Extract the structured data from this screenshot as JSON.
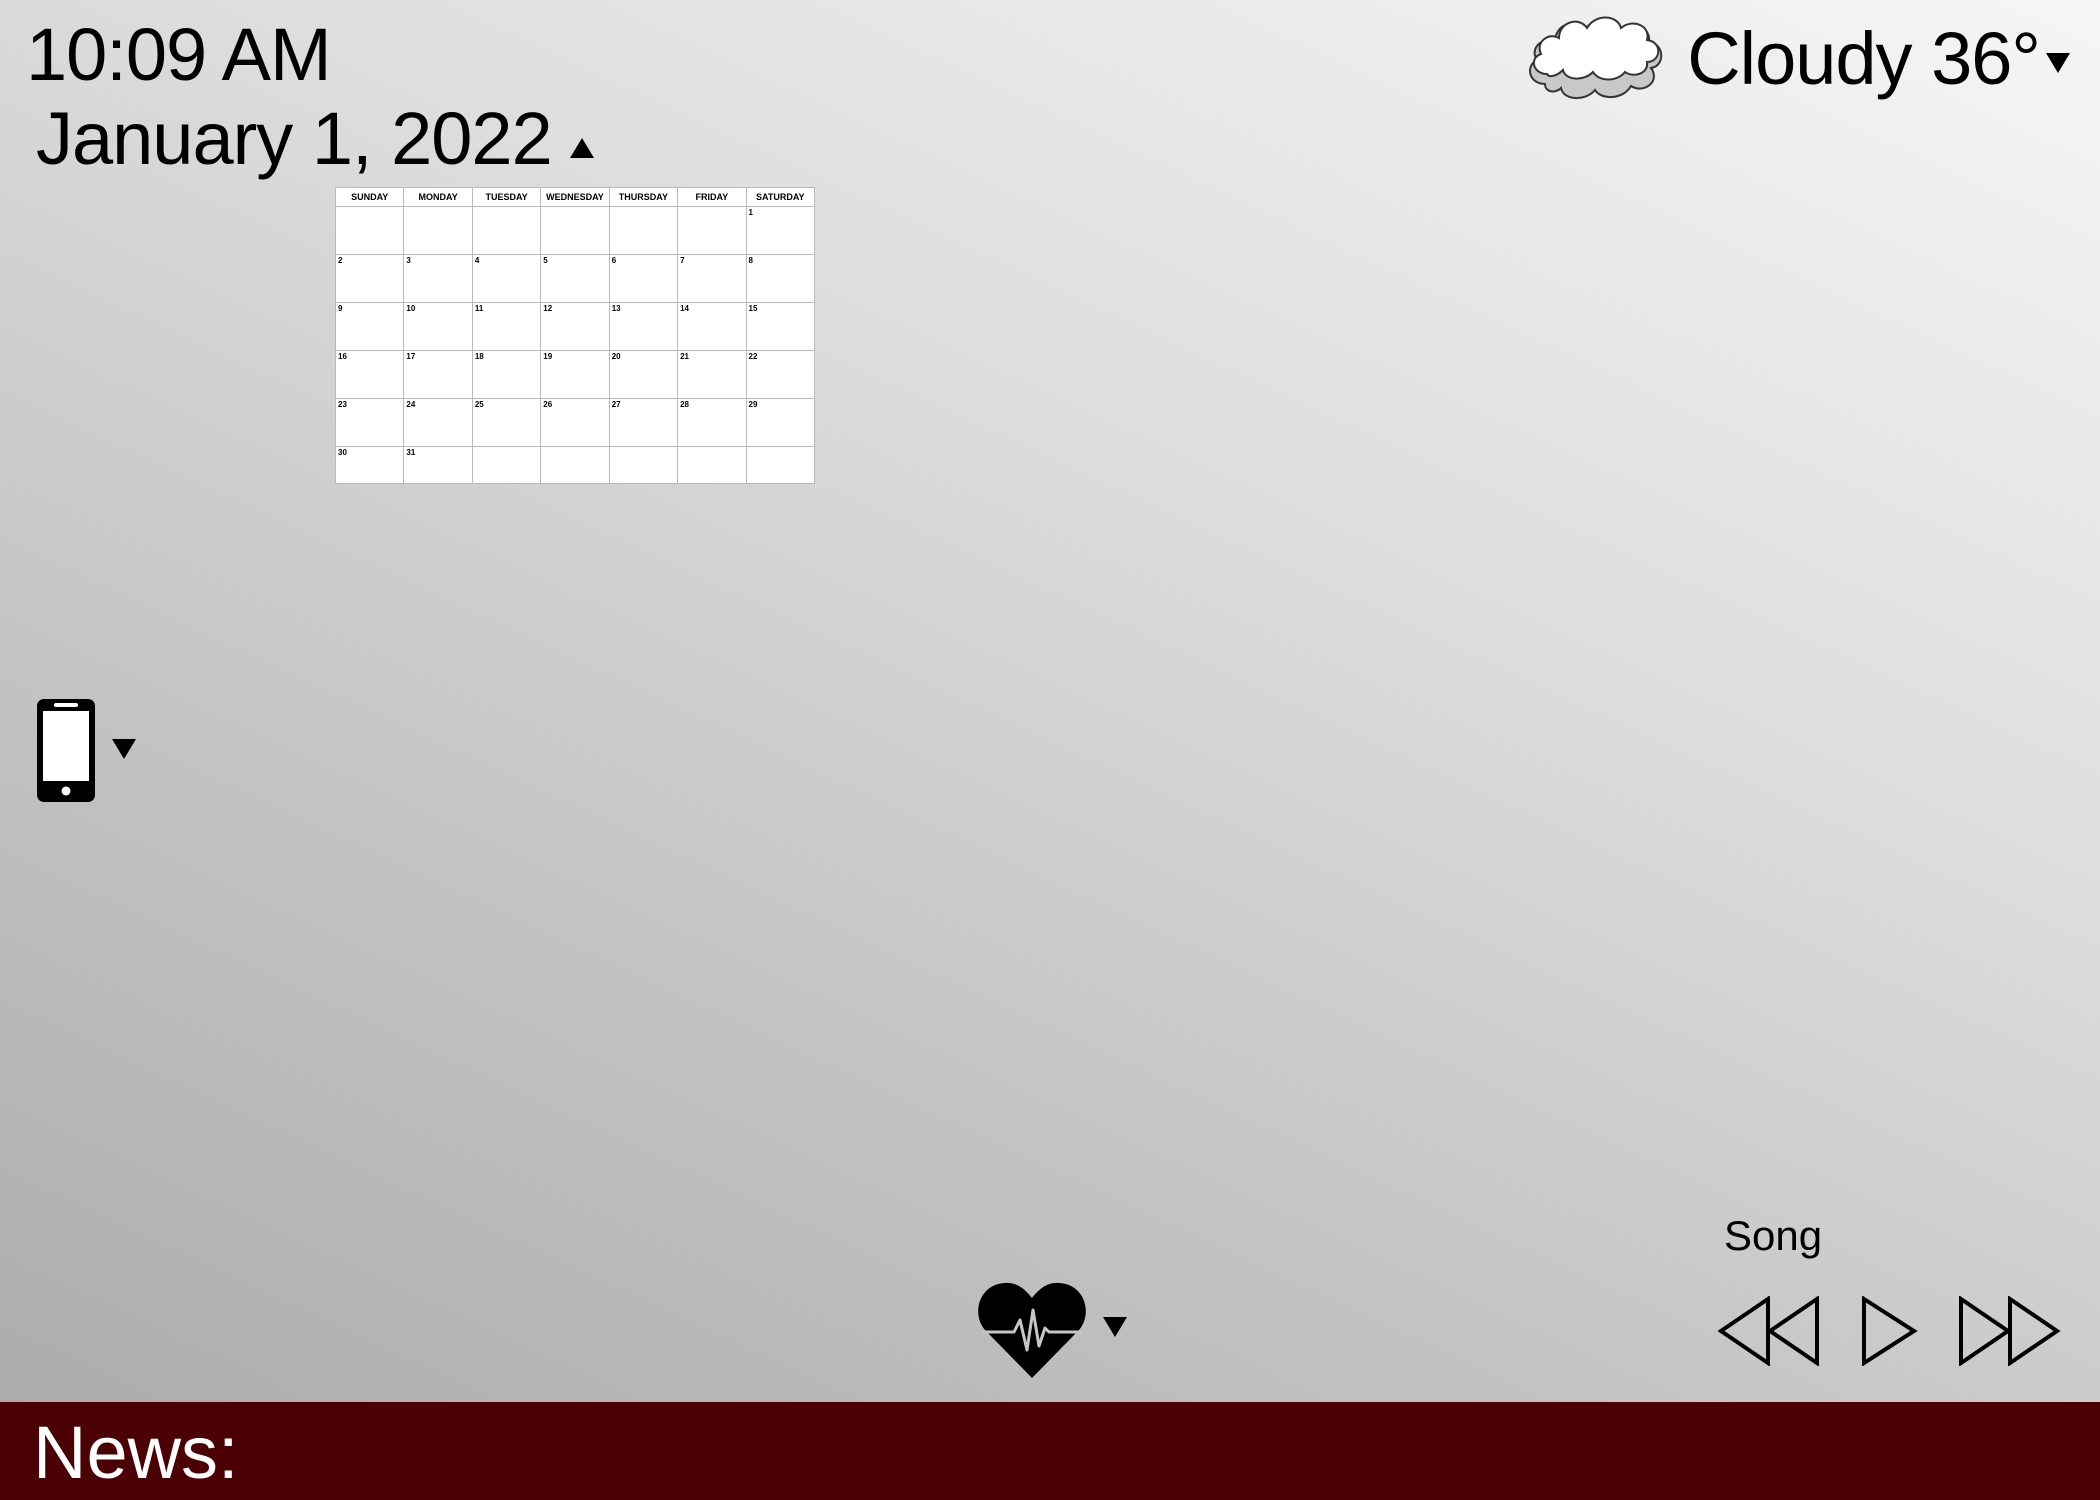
{
  "clock": {
    "time": "10:09 AM"
  },
  "date": {
    "label": "January 1, 2022"
  },
  "calendar": {
    "weekdays": [
      "SUNDAY",
      "MONDAY",
      "TUESDAY",
      "WEDNESDAY",
      "THURSDAY",
      "FRIDAY",
      "SATURDAY"
    ],
    "weeks": [
      [
        "",
        "",
        "",
        "",
        "",
        "",
        "1"
      ],
      [
        "2",
        "3",
        "4",
        "5",
        "6",
        "7",
        "8"
      ],
      [
        "9",
        "10",
        "11",
        "12",
        "13",
        "14",
        "15"
      ],
      [
        "16",
        "17",
        "18",
        "19",
        "20",
        "21",
        "22"
      ],
      [
        "23",
        "24",
        "25",
        "26",
        "27",
        "28",
        "29"
      ],
      [
        "30",
        "31",
        "",
        "",
        "",
        "",
        ""
      ]
    ]
  },
  "weather": {
    "label": "Cloudy 36°",
    "icon": "cloud-icon"
  },
  "phone": {
    "icon": "smartphone-icon"
  },
  "health": {
    "icon": "heart-pulse-icon"
  },
  "media": {
    "song_label": "Song",
    "controls": [
      "rewind-icon",
      "play-icon",
      "fast-forward-icon"
    ]
  },
  "news": {
    "label": "News:",
    "background": "#4b0003"
  }
}
